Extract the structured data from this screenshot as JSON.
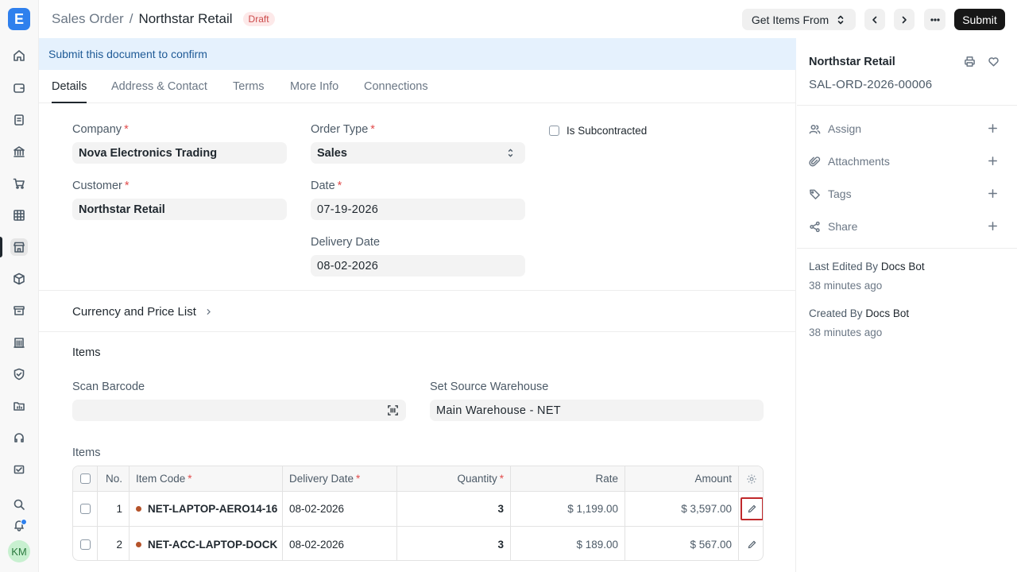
{
  "app": {
    "logo_letter": "E"
  },
  "header": {
    "breadcrumb_parent": "Sales Order",
    "breadcrumb_sep": "/",
    "breadcrumb_current": "Northstar Retail",
    "status_badge": "Draft",
    "get_items_label": "Get Items From",
    "submit_label": "Submit"
  },
  "banner": {
    "text": "Submit this document to confirm"
  },
  "tabs": [
    {
      "label": "Details"
    },
    {
      "label": "Address & Contact"
    },
    {
      "label": "Terms"
    },
    {
      "label": "More Info"
    },
    {
      "label": "Connections"
    }
  ],
  "form": {
    "company": {
      "label": "Company",
      "value": "Nova Electronics Trading"
    },
    "order_type": {
      "label": "Order Type",
      "value": "Sales"
    },
    "is_subcontracted": {
      "label": "Is Subcontracted"
    },
    "customer": {
      "label": "Customer",
      "value": "Northstar Retail"
    },
    "date": {
      "label": "Date",
      "value": "07-19-2026"
    },
    "delivery_date": {
      "label": "Delivery Date",
      "value": "08-02-2026"
    },
    "currency_section": "Currency and Price List",
    "items_section": "Items",
    "scan_barcode": {
      "label": "Scan Barcode",
      "value": ""
    },
    "source_warehouse": {
      "label": "Set Source Warehouse",
      "value": "Main Warehouse - NET"
    },
    "items_table_label": "Items"
  },
  "table": {
    "headers": {
      "no": "No.",
      "item_code": "Item Code",
      "delivery_date": "Delivery Date",
      "quantity": "Quantity",
      "rate": "Rate",
      "amount": "Amount"
    },
    "rows": [
      {
        "no": "1",
        "item_code": "NET-LAPTOP-AERO14-16",
        "delivery_date": "08-02-2026",
        "quantity": "3",
        "rate": "$ 1,199.00",
        "amount": "$ 3,597.00"
      },
      {
        "no": "2",
        "item_code": "NET-ACC-LAPTOP-DOCK",
        "delivery_date": "08-02-2026",
        "quantity": "3",
        "rate": "$ 189.00",
        "amount": "$ 567.00"
      }
    ]
  },
  "sidebar": {
    "title": "Northstar Retail",
    "doc_id": "SAL-ORD-2026-00006",
    "actions": [
      {
        "label": "Assign",
        "icon": "users-icon"
      },
      {
        "label": "Attachments",
        "icon": "paperclip-icon"
      },
      {
        "label": "Tags",
        "icon": "tag-icon"
      },
      {
        "label": "Share",
        "icon": "share-icon"
      }
    ],
    "last_edited_prefix": "Last Edited By",
    "last_edited_by": "Docs Bot",
    "last_edited_time": "38 minutes ago",
    "created_prefix": "Created By",
    "created_by": "Docs Bot",
    "created_time": "38 minutes ago"
  },
  "user": {
    "initials": "KM"
  },
  "colors": {
    "accent": "#2f80ed",
    "banner_bg": "#e5f1fd",
    "draft_badge": "#cc4b4b",
    "highlight": "#c0292b"
  }
}
